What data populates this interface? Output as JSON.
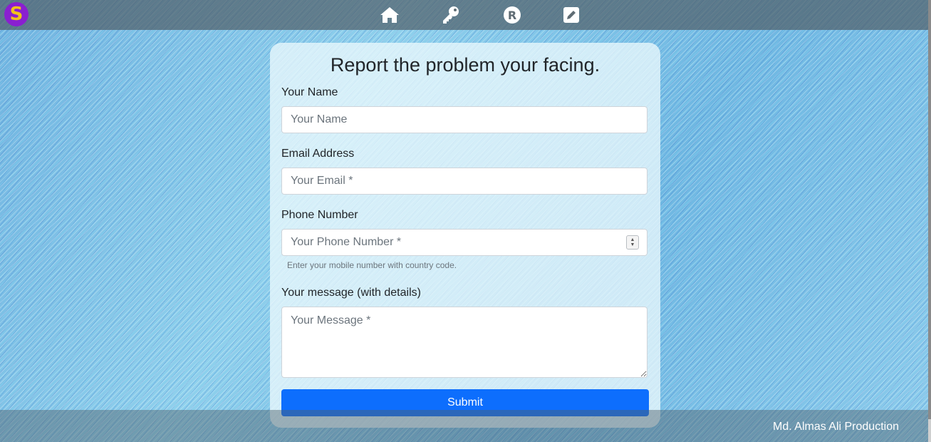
{
  "header": {
    "logo_letter": "S",
    "nav": [
      {
        "icon": "home-icon"
      },
      {
        "icon": "key-icon"
      },
      {
        "icon": "registered-icon"
      },
      {
        "icon": "edit-icon"
      }
    ]
  },
  "form": {
    "title": "Report the problem your facing.",
    "name_label": "Your Name",
    "name_placeholder": "Your Name",
    "email_label": "Email Address",
    "email_placeholder": "Your Email *",
    "phone_label": "Phone Number",
    "phone_placeholder": "Your Phone Number *",
    "phone_help": "Enter your mobile number with country code.",
    "message_label": "Your message (with details)",
    "message_placeholder": "Your Message *",
    "submit_label": "Submit"
  },
  "footer": {
    "credit": "Md. Almas Ali Production"
  },
  "colors": {
    "accent": "#0d6efd",
    "logo_bg": "#8a1fd0",
    "logo_letter": "#f2c21b"
  }
}
